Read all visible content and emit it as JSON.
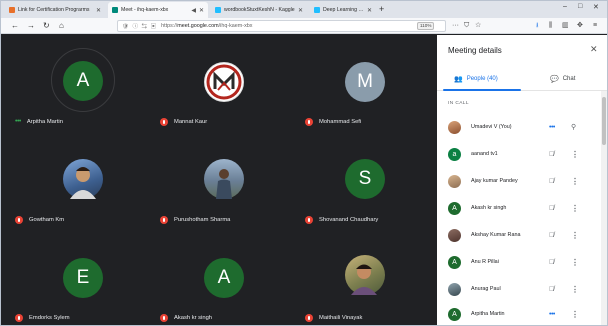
{
  "browser": {
    "tabs": [
      {
        "title": "Link for Certification Prograrms",
        "favicon_color": "#e8702a",
        "active": false
      },
      {
        "title": "Meet - ihq-kaem-xbx",
        "favicon_color": "#00897b",
        "active": true
      },
      {
        "title": "wordbookStuxtKeshN - Kaggle",
        "favicon_color": "#20beff",
        "active": false
      },
      {
        "title": "Deep Learning Tutorial for Beg",
        "favicon_color": "#20beff",
        "active": false
      }
    ],
    "url_prefix": "https://",
    "url_host": "meet.google.com",
    "url_path": "/ihq-kaem-xbx",
    "zoom": "110%"
  },
  "meeting": {
    "tiles": [
      {
        "name": "Arpitha Martin",
        "initial": "A",
        "color": "#1e6b2e",
        "speaking": true
      },
      {
        "name": "Mannat Kaur",
        "initial": "M",
        "color": "#ffffff",
        "logo": true
      },
      {
        "name": "Mohammad Sefi",
        "initial": "M",
        "color": "#8a9cab"
      },
      {
        "name": "Gowtham Km",
        "initial": "",
        "color": "#4a6fa5",
        "photo": true
      },
      {
        "name": "Purushotham Sharma",
        "initial": "",
        "color": "#5d6e86",
        "photo": true
      },
      {
        "name": "Shovanand Chaudhary",
        "initial": "S",
        "color": "#1e6b2e"
      },
      {
        "name": "Emdorks Sylem",
        "initial": "E",
        "color": "#1e6b2e"
      },
      {
        "name": "Akash kr singh",
        "initial": "A",
        "color": "#1e6b2e"
      },
      {
        "name": "Maithaili Vinayak",
        "initial": "",
        "color": "#6f7d55",
        "photo": true
      }
    ]
  },
  "panel": {
    "title": "Meeting details",
    "people_tab": "People (40)",
    "chat_tab": "Chat",
    "section": "IN CALL",
    "people": [
      {
        "name": "Umadevi V (You)",
        "initial": "",
        "color": "#a0522d",
        "photo": true,
        "you": true
      },
      {
        "name": "aanand tv1",
        "initial": "a",
        "color": "#0b8043"
      },
      {
        "name": "Ajay kumar Pandey",
        "initial": "",
        "color": "#b08968",
        "photo": true
      },
      {
        "name": "Akash kr singh",
        "initial": "A",
        "color": "#1e6b2e"
      },
      {
        "name": "Akshay Kumar Rana",
        "initial": "",
        "color": "#6d4c41",
        "photo": true
      },
      {
        "name": "Anu R Pillai",
        "initial": "A",
        "color": "#1e6b2e"
      },
      {
        "name": "Anurag Paul",
        "initial": "",
        "color": "#546e7a",
        "photo": true
      },
      {
        "name": "Arpitha Martin",
        "initial": "A",
        "color": "#1e6b2e",
        "speaking": true
      }
    ]
  }
}
